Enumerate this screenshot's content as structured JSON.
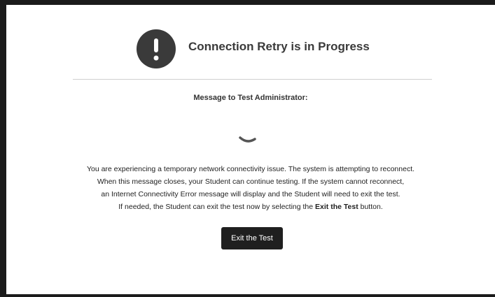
{
  "dialog": {
    "title": "Connection Retry is in Progress",
    "subtitle": "Message to Test Administrator:",
    "icon": "exclamation-icon",
    "message_lines": [
      "You are experiencing a temporary network connectivity issue. The system is attempting to reconnect.",
      "When this message closes, your Student can continue testing. If the system cannot reconnect,",
      "an Internet Connectivity Error message will display and the Student will need to exit the test."
    ],
    "last_line": {
      "before": "If needed, the Student can exit the test now by selecting the ",
      "bold": "Exit the Test",
      "after": " button."
    },
    "exit_button_label": "Exit the Test"
  },
  "colors": {
    "icon_bg": "#3a3a3a",
    "button_bg": "#1f1f1f",
    "frame": "#1b1b1b"
  }
}
